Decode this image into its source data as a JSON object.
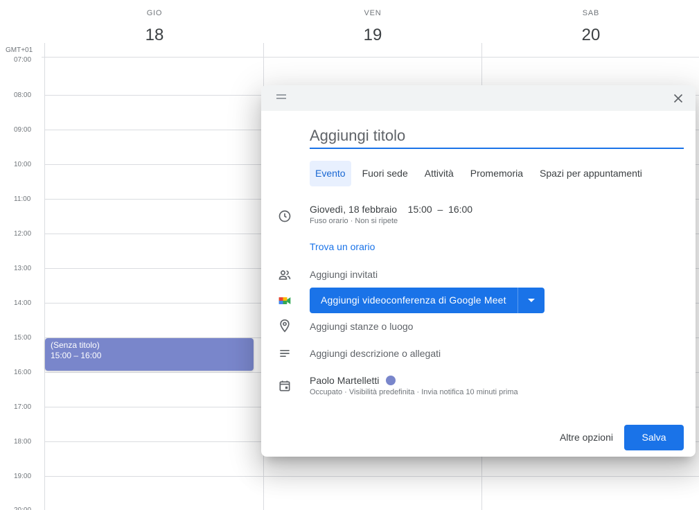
{
  "calendar": {
    "timezone": "GMT+01",
    "days": [
      {
        "name": "GIO",
        "number": "18"
      },
      {
        "name": "VEN",
        "number": "19"
      },
      {
        "name": "SAB",
        "number": "20"
      }
    ],
    "hours": [
      "07:00",
      "08:00",
      "09:00",
      "10:00",
      "11:00",
      "12:00",
      "13:00",
      "14:00",
      "15:00",
      "16:00",
      "17:00",
      "18:00",
      "19:00",
      "20:00"
    ],
    "event": {
      "title": "(Senza titolo)",
      "time": "15:00 – 16:00",
      "color": "#7986cb"
    }
  },
  "dialog": {
    "close_icon": "close-icon",
    "title_placeholder": "Aggiungi titolo",
    "tabs": [
      "Evento",
      "Fuori sede",
      "Attività",
      "Promemoria",
      "Spazi per appuntamenti"
    ],
    "active_tab": "Evento",
    "datetime": {
      "date": "Giovedì, 18 febbraio",
      "start": "15:00",
      "separator": "–",
      "end": "16:00",
      "sub": "Fuso orario · Non si ripete"
    },
    "find_time": "Trova un orario",
    "guests": "Aggiungi invitati",
    "meet_button": "Aggiungi videoconferenza di Google Meet",
    "location": "Aggiungi stanze o luogo",
    "description": "Aggiungi descrizione o allegati",
    "calendar_owner": {
      "name": "Paolo Martelletti",
      "sub": "Occupato · Visibilità predefinita · Invia notifica 10 minuti prima",
      "color": "#7986cb"
    },
    "more_options": "Altre opzioni",
    "save": "Salva",
    "accent": "#1a73e8"
  }
}
